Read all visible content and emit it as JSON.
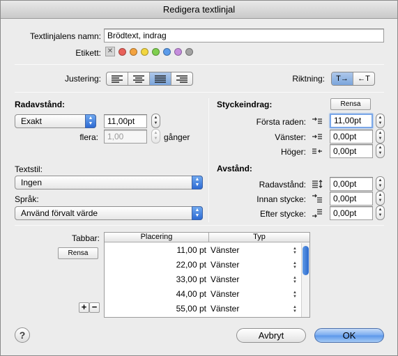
{
  "window": {
    "title": "Redigera textlinjal"
  },
  "name": {
    "label": "Textlinjalens namn:",
    "value": "Brödtext, indrag"
  },
  "tag": {
    "label": "Etikett:",
    "clear_glyph": "✕",
    "colors": [
      "#e8615a",
      "#f3a340",
      "#f2d640",
      "#7fcf4f",
      "#5b9bea",
      "#c58ddd",
      "#a3a3a3"
    ]
  },
  "alignment": {
    "label": "Justering:",
    "selected": "justify"
  },
  "direction": {
    "label": "Riktning:",
    "ltr": "T→",
    "rtl": "←T"
  },
  "line_spacing": {
    "heading": "Radavstånd:",
    "mode": "Exakt",
    "value": "11,00pt",
    "multiple_label": "flera:",
    "multiple_value": "1,00",
    "times_label": "gånger"
  },
  "text_style": {
    "label": "Textstil:",
    "value": "Ingen"
  },
  "language": {
    "label": "Språk:",
    "value": "Använd förvalt värde"
  },
  "indent": {
    "heading": "Styckeindrag:",
    "reset_label": "Rensa",
    "first_label": "Första raden:",
    "first_value": "11,00pt",
    "left_label": "Vänster:",
    "left_value": "0,00pt",
    "right_label": "Höger:",
    "right_value": "0,00pt"
  },
  "spacing": {
    "heading": "Avstånd:",
    "line_label": "Radavstånd:",
    "line_value": "0,00pt",
    "before_label": "Innan stycke:",
    "before_value": "0,00pt",
    "after_label": "Efter stycke:",
    "after_value": "0,00pt"
  },
  "tabs": {
    "label": "Tabbar:",
    "reset_label": "Rensa",
    "col_position": "Placering",
    "col_type": "Typ",
    "add_label": "+",
    "remove_label": "−",
    "rows": [
      {
        "position": "11,00 pt",
        "type": "Vänster"
      },
      {
        "position": "22,00 pt",
        "type": "Vänster"
      },
      {
        "position": "33,00 pt",
        "type": "Vänster"
      },
      {
        "position": "44,00 pt",
        "type": "Vänster"
      },
      {
        "position": "55,00 pt",
        "type": "Vänster"
      }
    ]
  },
  "footer": {
    "help": "?",
    "cancel": "Avbryt",
    "ok": "OK"
  }
}
